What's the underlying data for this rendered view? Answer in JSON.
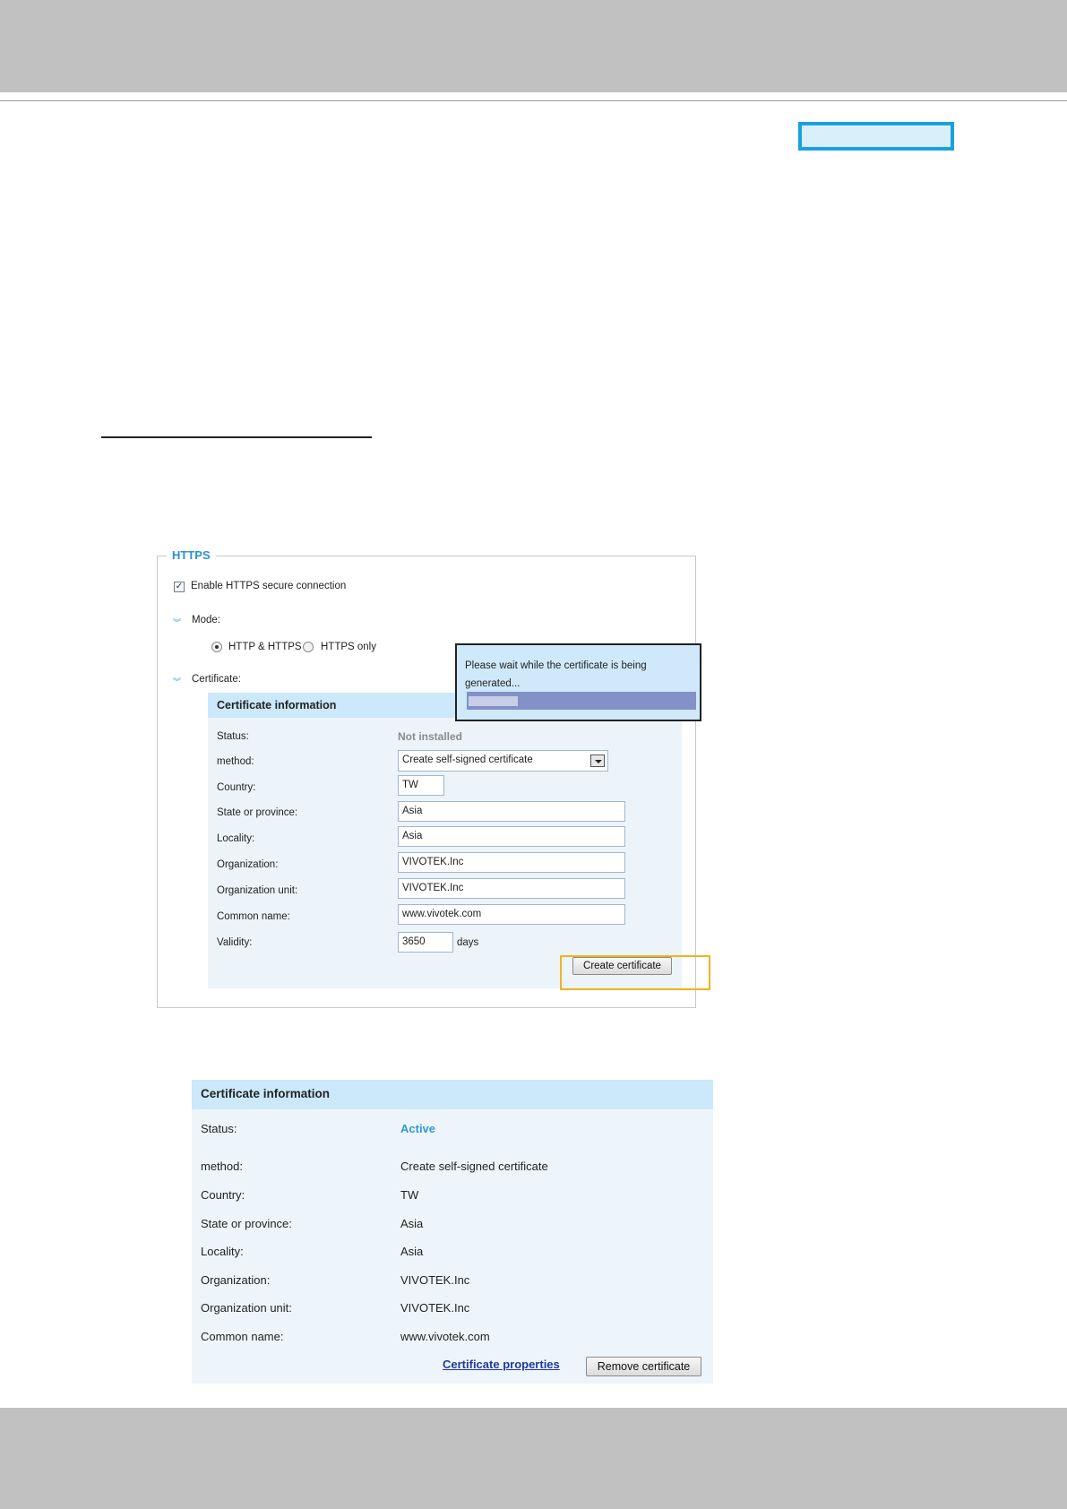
{
  "https": {
    "legend": "HTTPS",
    "enable_label": "Enable HTTPS secure connection",
    "enable_checked": true,
    "mode_label": "Mode:",
    "mode_options": [
      "HTTP & HTTPS",
      "HTTPS only"
    ],
    "mode_selected": "HTTP & HTTPS",
    "certificate_label": "Certificate:"
  },
  "popup": {
    "message": "Please wait while the certificate is being generated...",
    "progress_fraction": 0.22
  },
  "form": {
    "header": "Certificate information",
    "status_label": "Status:",
    "status_value": "Not installed",
    "method_label": "method:",
    "method_value": "Create self-signed certificate",
    "country_label": "Country:",
    "country_value": "TW",
    "state_label": "State or province:",
    "state_value": "Asia",
    "locality_label": "Locality:",
    "locality_value": "Asia",
    "org_label": "Organization:",
    "org_value": "VIVOTEK.Inc",
    "org_unit_label": "Organization unit:",
    "org_unit_value": "VIVOTEK.Inc",
    "common_label": "Common name:",
    "common_value": "www.vivotek.com",
    "validity_label": "Validity:",
    "validity_value": "3650",
    "validity_unit": "days",
    "create_button": "Create certificate"
  },
  "info": {
    "header": "Certificate information",
    "status_label": "Status:",
    "status_value": "Active",
    "method_label": "method:",
    "method_value": "Create self-signed certificate",
    "country_label": "Country:",
    "country_value": "TW",
    "state_label": "State or province:",
    "state_value": "Asia",
    "locality_label": "Locality:",
    "locality_value": "Asia",
    "org_label": "Organization:",
    "org_value": "VIVOTEK.Inc",
    "org_unit_label": "Organization unit:",
    "org_unit_value": "VIVOTEK.Inc",
    "common_label": "Common name:",
    "common_value": "www.vivotek.com",
    "properties_link": "Certificate properties",
    "remove_button": "Remove certificate"
  },
  "colors": {
    "accent_blue": "#2b8fd6",
    "highlight_orange": "#f2b21f",
    "panel_header": "#cce8fb",
    "panel_body": "#ecf4fa"
  },
  "icons": {
    "bullet": "double-chevron-down-icon",
    "dropdown": "dropdown-arrow-icon",
    "checkbox": "checkbox-checked-icon"
  }
}
